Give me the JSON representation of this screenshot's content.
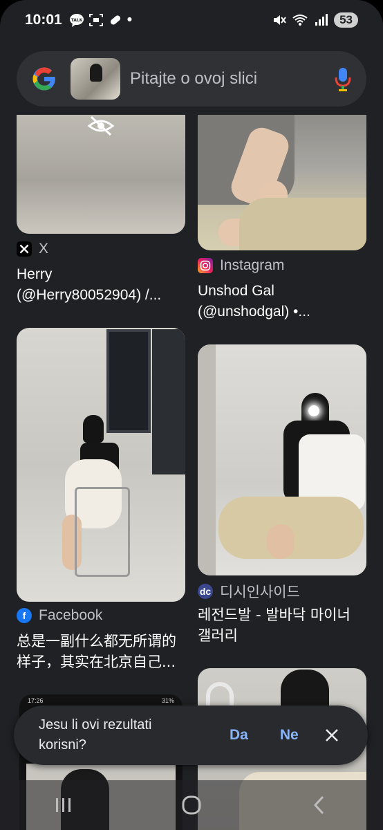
{
  "status_bar": {
    "time": "10:01",
    "talk_badge": "TALK",
    "dot": "•",
    "battery": "53"
  },
  "search": {
    "placeholder": "Pitajte o ovoj slici"
  },
  "results": [
    {
      "source": "X",
      "title_line1": "Herry",
      "title_line2": "(@Herry80052904) /..."
    },
    {
      "source": "Instagram",
      "title_line1": "Unshod Gal",
      "title_line2": "(@unshodgal) •..."
    },
    {
      "source": "Facebook",
      "title_line1": "总是一副什么都无所谓的",
      "title_line2": "样子，其实在北京自己..."
    },
    {
      "source": "디시인사이드",
      "title_line1": "레전드발 - 발바닥 마이너",
      "title_line2": "갤러리"
    }
  ],
  "embedded_screenshot_status": {
    "time": "17:26",
    "battery": "31%"
  },
  "feedback": {
    "question": "Jesu li ovi rezultati korisni?",
    "yes": "Da",
    "no": "Ne"
  },
  "colors": {
    "background": "#202124",
    "accent": "#8ab4f8",
    "search_bar": "#303134"
  },
  "icons": [
    "google-logo-icon",
    "mic-icon",
    "hidden-eye-icon",
    "x-logo-icon",
    "instagram-icon",
    "facebook-icon",
    "dcinside-icon",
    "close-icon",
    "recents-icon",
    "home-icon",
    "back-icon"
  ]
}
